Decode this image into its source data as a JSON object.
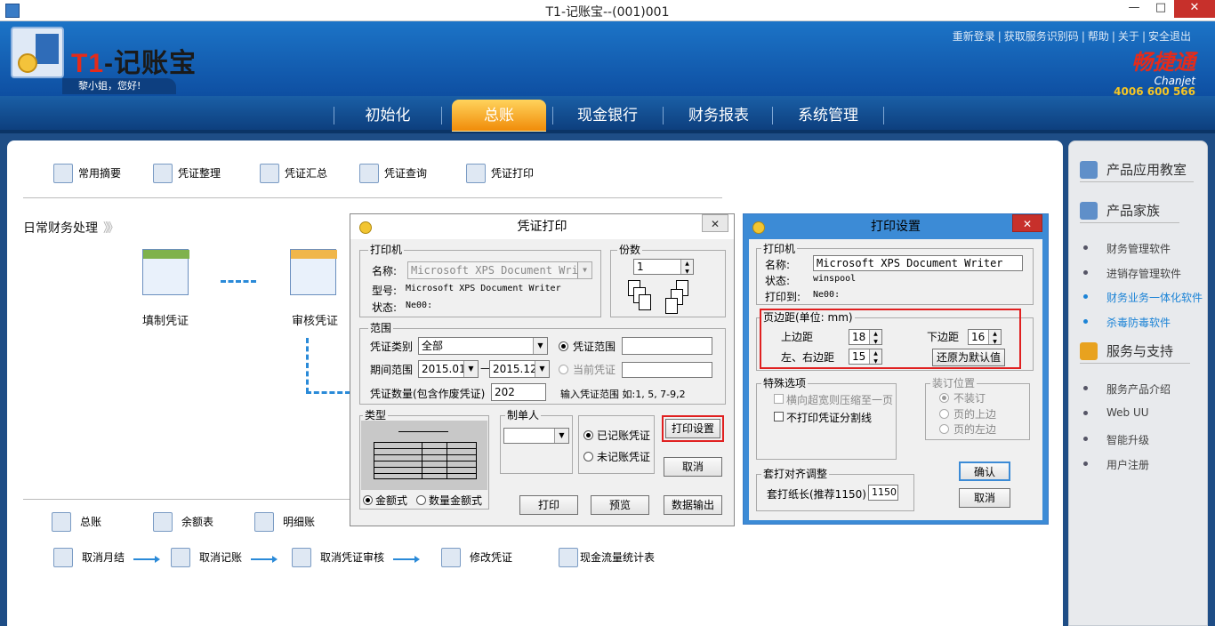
{
  "window": {
    "title": "T1-记账宝--(001)001",
    "controls": {
      "minimize": "—",
      "maximize": "□",
      "close": "✕"
    }
  },
  "header": {
    "logo_text_prefix": "T1",
    "logo_text_suffix": "-记账宝",
    "greeting": "黎小姐，您好!",
    "top_links": [
      "重新登录",
      "获取服务识别码",
      "帮助",
      "关于",
      "安全退出"
    ],
    "brand_name": "畅捷通",
    "brand_sub": "Chanjet",
    "brand_phone": "4006 600 566"
  },
  "nav": {
    "items": [
      "初始化",
      "总账",
      "现金银行",
      "财务报表",
      "系统管理"
    ],
    "active": "总账"
  },
  "toolbar": {
    "items": [
      "常用摘要",
      "凭证整理",
      "凭证汇总",
      "凭证查询",
      "凭证打印"
    ]
  },
  "daily": {
    "title": "日常财务处理",
    "arrows": "》》",
    "steps": [
      "填制凭证",
      "审核凭证"
    ]
  },
  "bottom_tools": {
    "row1": [
      "总账",
      "余额表",
      "明细账"
    ],
    "row2": [
      "取消月结",
      "取消记账",
      "取消凭证审核",
      "修改凭证",
      "现金流量统计表"
    ]
  },
  "sidebar": {
    "sections": [
      {
        "title": "产品应用教室",
        "items": []
      },
      {
        "title": "产品家族",
        "items": [
          "财务管理软件",
          "进销存管理软件",
          "财务业务一体化软件",
          "杀毒防毒软件"
        ]
      },
      {
        "title": "服务与支持",
        "items": [
          "服务产品介绍",
          "Web UU",
          "智能升级",
          "用户注册"
        ]
      }
    ],
    "highlighted": [
      "财务业务一体化软件",
      "杀毒防毒软件"
    ]
  },
  "voucher_print_dialog": {
    "title": "凭证打印",
    "close": "✕",
    "printer_group": "打印机",
    "name_label": "名称:",
    "printer_name": "Microsoft XPS Document Writer",
    "model_label": "型号:",
    "model_value": "Microsoft XPS Document Writer",
    "status_label": "状态:",
    "status_value": "Ne00:",
    "copies_group": "份数",
    "copies_value": "1",
    "range_group": "范围",
    "voucher_type_label": "凭证类别",
    "voucher_type_value": "全部",
    "voucher_range_label": "凭证范围",
    "voucher_range_value": "",
    "period_label": "期间范围",
    "period_from": "2015.01",
    "period_to": "2015.12",
    "current_voucher_label": "当前凭证",
    "count_label": "凭证数量(包含作废凭证)",
    "count_value": "202",
    "range_hint": "输入凭证范围 如:1, 5, 7-9,2",
    "type_group": "类型",
    "type_amount": "金额式",
    "type_qty_amount": "数量金额式",
    "maker_group": "制单人",
    "posted": "已记账凭证",
    "unposted": "未记账凭证",
    "btn_print_settings": "打印设置",
    "btn_cancel": "取消",
    "btn_print": "打印",
    "btn_preview": "预览",
    "btn_export": "数据输出"
  },
  "print_settings_dialog": {
    "title": "打印设置",
    "close": "✕",
    "printer_group": "打印机",
    "name_label": "名称:",
    "name_value": "Microsoft XPS Document Writer",
    "status_label": "状态:",
    "status_value": "winspool",
    "print_to_label": "打印到:",
    "print_to_value": "Ne00:",
    "margin_group": "页边距(单位: mm)",
    "top_label": "上边距",
    "top_value": "18",
    "bottom_label": "下边距",
    "bottom_value": "16",
    "lr_label": "左、右边距",
    "lr_value": "15",
    "btn_default": "还原为默认值",
    "special_group": "特殊选项",
    "opt_shrink": "横向超宽则压缩至一页",
    "opt_no_split": "不打印凭证分割线",
    "binding_group": "装订位置",
    "bind_none": "不装订",
    "bind_top": "页的上边",
    "bind_left": "页的左边",
    "align_group": "套打对齐调整",
    "paper_len_label": "套打纸长(推荐1150)",
    "paper_len_value": "1150",
    "btn_ok": "确认",
    "btn_cancel": "取消"
  }
}
